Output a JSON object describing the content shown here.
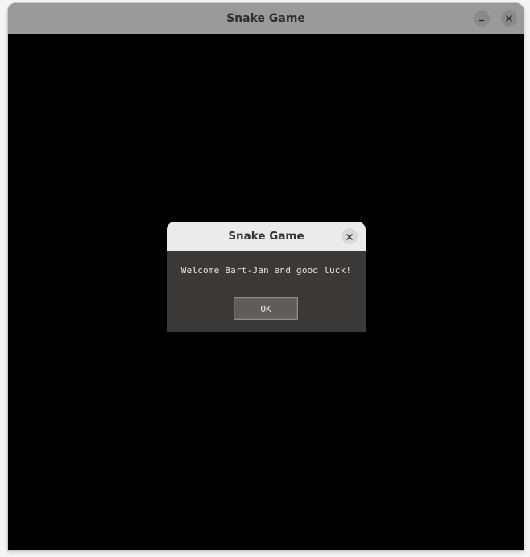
{
  "window": {
    "title": "Snake Game",
    "controls": {
      "minimize_icon": "minimize-icon",
      "close_icon": "close-icon"
    }
  },
  "game": {
    "background_color": "#000000"
  },
  "dialog": {
    "title": "Snake Game",
    "message": "Welcome Bart-Jan and good luck!",
    "ok_label": "OK",
    "close_icon": "close-icon"
  }
}
